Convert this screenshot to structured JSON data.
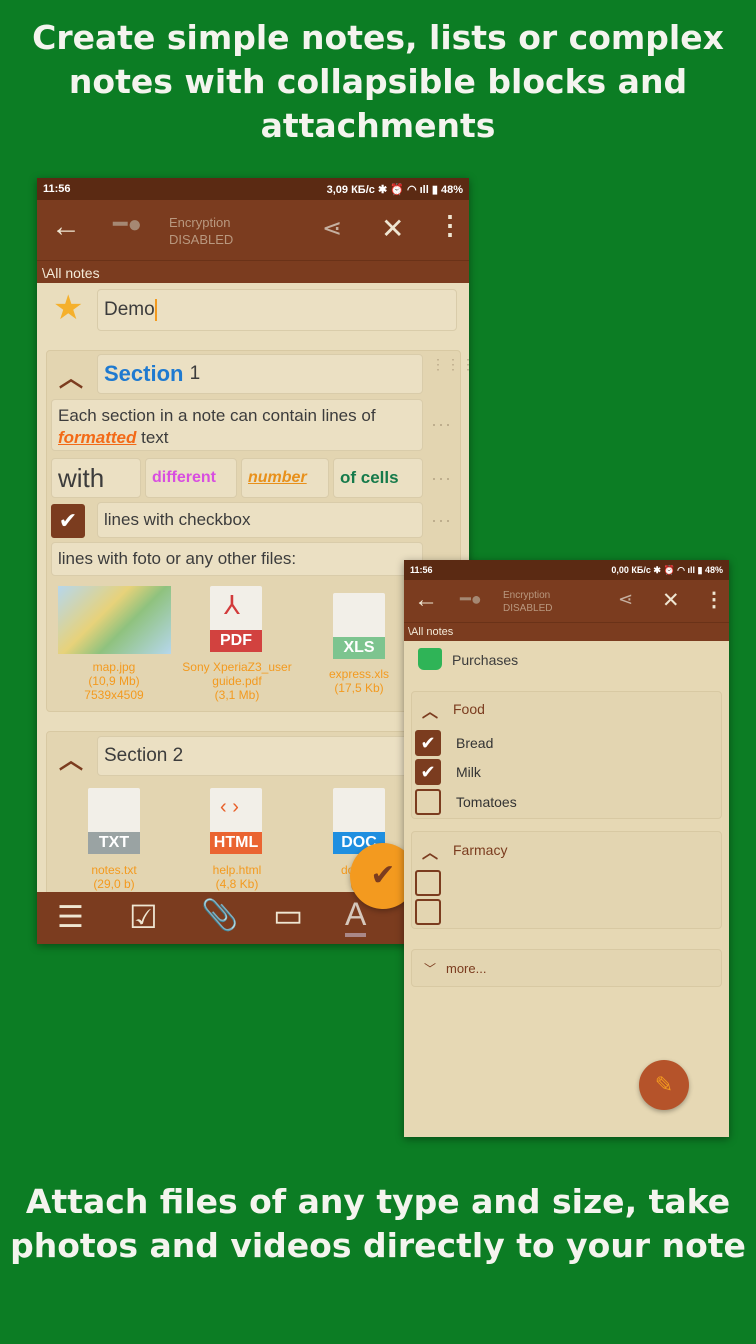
{
  "headline_top": "Create simple notes, lists or complex notes with collapsible blocks and attachments",
  "headline_bottom": "Attach files of any type and size, take photos and videos directly to your note",
  "colors": {
    "background": "#0c7d24",
    "toolbar": "#7b3c1f",
    "status_bar": "#5b2a13",
    "content": "#e9ddbd",
    "accent": "#f39a1f"
  },
  "left": {
    "status": {
      "time": "11:56",
      "speed": "3,09 КБ/с",
      "battery": "48%"
    },
    "toolbar": {
      "enc_title": "Encryption",
      "enc_state": "DISABLED"
    },
    "breadcrumb": "\\All notes",
    "title": "Demo",
    "section1": {
      "label": "Section",
      "num": "1",
      "line1a": "Each section in a note can contain lines of",
      "line1b": "formatted",
      "line1c": " text",
      "cells": [
        "with",
        "different",
        "number",
        "of cells"
      ],
      "checkbox_line": "lines with checkbox",
      "files_line": "lines with foto or any other files:"
    },
    "attachments1": [
      {
        "name": "map.jpg",
        "size": "(10,9 Mb)",
        "extra": "7539x4509"
      },
      {
        "name": "Sony XperiaZ3_user guide.pdf",
        "size": "(3,1 Mb)",
        "type": "PDF"
      },
      {
        "name": "express.xls",
        "size": "(17,5 Kb)",
        "type": "XLS"
      }
    ],
    "section2": {
      "label": "Section 2"
    },
    "attachments2": [
      {
        "name": "notes.txt",
        "size": "(29,0 b)",
        "type": "TXT"
      },
      {
        "name": "help.html",
        "size": "(4,8 Kb)",
        "type": "HTML"
      },
      {
        "name": "docum",
        "size": "(32",
        "type": "DOC"
      }
    ],
    "bottom_icons": [
      "add-lines-icon",
      "add-checkbox-icon",
      "attach-icon",
      "add-section-icon",
      "text-format-icon"
    ]
  },
  "right": {
    "status": {
      "time": "11:56",
      "speed": "0,00 КБ/с",
      "battery": "48%"
    },
    "toolbar": {
      "enc_title": "Encryption",
      "enc_state": "DISABLED"
    },
    "breadcrumb": "\\All notes",
    "title": "Purchases",
    "food": {
      "label": "Food",
      "items": [
        {
          "text": "Bread",
          "checked": true
        },
        {
          "text": "Milk",
          "checked": true
        },
        {
          "text": "Tomatoes",
          "checked": false
        }
      ]
    },
    "farmacy": {
      "label": "Farmacy"
    },
    "more": "more..."
  }
}
